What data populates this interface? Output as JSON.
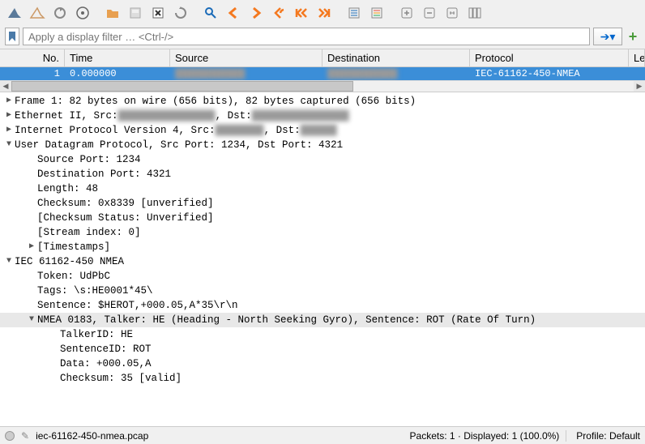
{
  "filter": {
    "placeholder": "Apply a display filter … <Ctrl-/>"
  },
  "columns": {
    "no": "No.",
    "time": "Time",
    "source": "Source",
    "destination": "Destination",
    "protocol": "Protocol",
    "length": "Leı"
  },
  "packets": [
    {
      "no": "1",
      "time": "0.000000",
      "source": "",
      "destination": "",
      "protocol": "IEC-61162-450-NMEA",
      "length": ""
    }
  ],
  "tree": {
    "frame": "Frame 1: 82 bytes on wire (656 bits), 82 bytes captured (656 bits)",
    "eth_prefix": "Ethernet II, Src: ",
    "eth_dst_label": ", Dst: ",
    "ip_prefix": "Internet Protocol Version 4, Src: ",
    "ip_dst_label": ", Dst: ",
    "udp": "User Datagram Protocol, Src Port: 1234, Dst Port: 4321",
    "udp_src": "Source Port: 1234",
    "udp_dst": "Destination Port: 4321",
    "udp_len": "Length: 48",
    "udp_cksum": "Checksum: 0x8339 [unverified]",
    "udp_cksum_status": "[Checksum Status: Unverified]",
    "udp_stream": "[Stream index: 0]",
    "udp_timestamps": "[Timestamps]",
    "iec": "IEC 61162-450 NMEA",
    "iec_token": "Token: UdPbC",
    "iec_tags": "Tags: \\s:HE0001*45\\",
    "iec_sentence": "Sentence: $HEROT,+000.05,A*35\\r\\n",
    "nmea": "NMEA 0183, Talker: HE (Heading - North Seeking Gyro), Sentence: ROT (Rate Of Turn)",
    "nmea_talker": "TalkerID: HE",
    "nmea_sentence": "SentenceID: ROT",
    "nmea_data": "Data: +000.05,A",
    "nmea_cksum": "Checksum: 35 [valid]"
  },
  "status": {
    "file": "iec-61162-450-nmea.pcap",
    "stats": "Packets: 1 · Displayed: 1 (100.0%)",
    "profile": "Profile: Default"
  }
}
